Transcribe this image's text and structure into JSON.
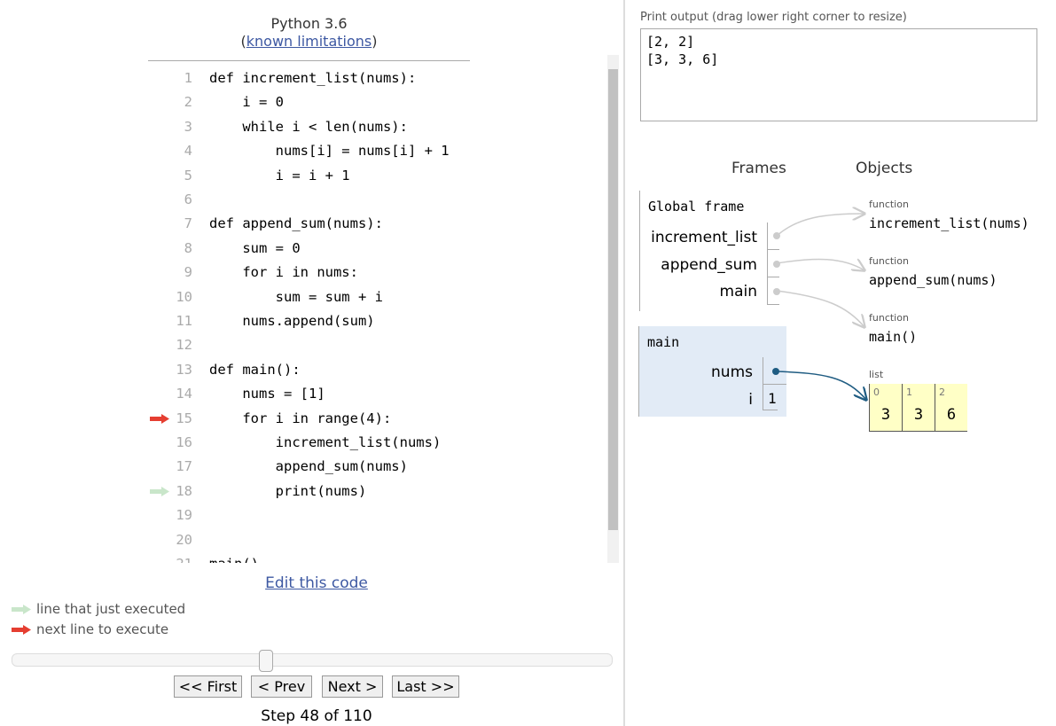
{
  "header": {
    "title": "Python 3.6",
    "limitations_link": "known limitations"
  },
  "code": {
    "lines": [
      "def increment_list(nums):",
      "    i = 0",
      "    while i < len(nums):",
      "        nums[i] = nums[i] + 1",
      "        i = i + 1",
      "",
      "def append_sum(nums):",
      "    sum = 0",
      "    for i in nums:",
      "        sum = sum + i",
      "    nums.append(sum)",
      "",
      "def main():",
      "    nums = [1]",
      "    for i in range(4):",
      "        increment_list(nums)",
      "        append_sum(nums)",
      "        print(nums)",
      "",
      "",
      "main()"
    ],
    "next_line": 15,
    "just_executed_line": 18
  },
  "colors": {
    "next_arrow": "#e53e31",
    "executed_arrow": "#c9e6ca",
    "link": "#3d58a2",
    "frame_bg": "#e2ebf6",
    "list_bg": "#ffffc6",
    "pointer": "#1f5c82"
  },
  "edit_link": "Edit this code",
  "legend": {
    "executed": "line that just executed",
    "next": "next line to execute"
  },
  "slider": {
    "step": 48,
    "total": 110
  },
  "nav": {
    "first": "<< First",
    "prev": "< Prev",
    "next": "Next >",
    "last": "Last >>"
  },
  "step_text": "Step 48 of 110",
  "output": {
    "label": "Print output (drag lower right corner to resize)",
    "text": "[2, 2]\n[3, 3, 6]"
  },
  "viz": {
    "frames_header": "Frames",
    "objects_header": "Objects",
    "global_frame": {
      "title": "Global frame",
      "vars": [
        "increment_list",
        "append_sum",
        "main"
      ]
    },
    "main_frame": {
      "title": "main",
      "vars": [
        {
          "name": "nums"
        },
        {
          "name": "i",
          "value": "1"
        }
      ]
    },
    "objects": [
      {
        "type": "function",
        "name": "increment_list(nums)"
      },
      {
        "type": "function",
        "name": "append_sum(nums)"
      },
      {
        "type": "function",
        "name": "main()"
      }
    ],
    "list": {
      "type": "list",
      "items": [
        {
          "index": "0",
          "value": "3"
        },
        {
          "index": "1",
          "value": "3"
        },
        {
          "index": "2",
          "value": "6"
        }
      ]
    }
  }
}
